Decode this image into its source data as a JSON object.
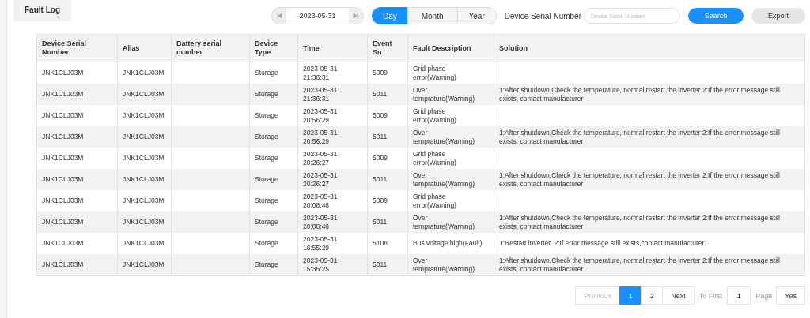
{
  "tab": {
    "label": "Fault Log"
  },
  "toolbar": {
    "date": "2023-05-31",
    "periods": [
      {
        "label": "Day",
        "selected": true
      },
      {
        "label": "Month",
        "selected": false
      },
      {
        "label": "Year",
        "selected": false
      }
    ],
    "serial_label": "Device Serial Number",
    "serial_field": {
      "placeholder": "Device Serial Number"
    },
    "search": "Search",
    "export": "Export"
  },
  "table": {
    "columns": [
      "Device Serial Number",
      "Alias",
      "Battery serial number",
      "Device Type",
      "Time",
      "Event Sn",
      "Fault Description",
      "Solution"
    ],
    "rows": [
      [
        "JNK1CLJ03M",
        "JNK1CLJ03M",
        "",
        "Storage",
        "2023-05-31 21:36:31",
        "5009",
        "Grid phase error(Warning)",
        ""
      ],
      [
        "JNK1CLJ03M",
        "JNK1CLJ03M",
        "",
        "Storage",
        "2023-05-31 21:36:31",
        "5011",
        "Over temprature(Warning)",
        "1:After shutdown,Check the temperature, normal restart the inverter 2:If the error message still exists, contact manufacturer"
      ],
      [
        "JNK1CLJ03M",
        "JNK1CLJ03M",
        "",
        "Storage",
        "2023-05-31 20:56:29",
        "5009",
        "Grid phase error(Warning)",
        ""
      ],
      [
        "JNK1CLJ03M",
        "JNK1CLJ03M",
        "",
        "Storage",
        "2023-05-31 20:56:29",
        "5011",
        "Over temprature(Warning)",
        "1:After shutdown,Check the temperature, normal restart the inverter 2:If the error message still exists, contact manufacturer"
      ],
      [
        "JNK1CLJ03M",
        "JNK1CLJ03M",
        "",
        "Storage",
        "2023-05-31 20:26:27",
        "5009",
        "Grid phase error(Warning)",
        ""
      ],
      [
        "JNK1CLJ03M",
        "JNK1CLJ03M",
        "",
        "Storage",
        "2023-05-31 20:26:27",
        "5011",
        "Over temprature(Warning)",
        "1:After shutdown,Check the temperature, normal restart the inverter 2:If the error message still exists, contact manufacturer"
      ],
      [
        "JNK1CLJ03M",
        "JNK1CLJ03M",
        "",
        "Storage",
        "2023-05-31 20:08:46",
        "5009",
        "Grid phase error(Warning)",
        ""
      ],
      [
        "JNK1CLJ03M",
        "JNK1CLJ03M",
        "",
        "Storage",
        "2023-05-31 20:08:46",
        "5011",
        "Over temprature(Warning)",
        "1:After shutdown,Check the temperature, normal restart the inverter 2:If the error message still exists, contact manufacturer"
      ],
      [
        "JNK1CLJ03M",
        "JNK1CLJ03M",
        "",
        "Storage",
        "2023-05-31 16:55:29",
        "5108",
        "Bus voltage high(Fault)",
        "1:Restart inverter. 2:If error message still exists,contact manufacturer."
      ],
      [
        "JNK1CLJ03M",
        "JNK1CLJ03M",
        "",
        "Storage",
        "2023-05-31 15:35:25",
        "5011",
        "Over temprature(Warning)",
        "1:After shutdown,Check the temperature, normal restart the inverter 2:If the error message still exists, contact manufacturer"
      ]
    ]
  },
  "pagination": {
    "previous": {
      "label": "Previous",
      "disabled": true
    },
    "pages": [
      {
        "label": "1",
        "selected": true
      },
      {
        "label": "2",
        "selected": false
      }
    ],
    "next": "Next",
    "to_first": "To First",
    "page_field": "1",
    "page_label": "Page",
    "go": "Yes"
  }
}
